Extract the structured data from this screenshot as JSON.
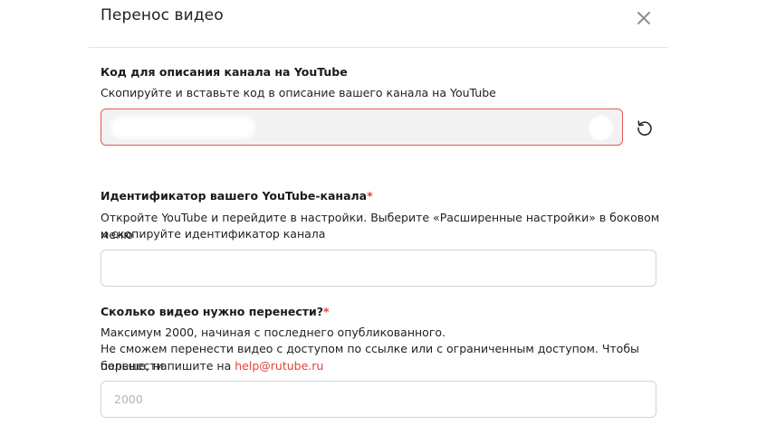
{
  "dialog": {
    "title": "Перенос видео",
    "close_icon": "close-icon"
  },
  "code_section": {
    "label": "Код для описания канала на YouTube",
    "hint": "Скопируйте и вставьте код в описание вашего канала на YouTube",
    "value": "",
    "refresh_icon": "refresh-icon",
    "border_color": "#e35a55"
  },
  "channel_section": {
    "label": "Идентификатор вашего YouTube-канала",
    "required_mark": "*",
    "hint_line1": "Откройте YouTube и перейдите в настройки. Выберите «Расширенные настройки» в боковом меню",
    "hint_line2": "и скопируйте идентификатор канала",
    "value": "",
    "placeholder": ""
  },
  "count_section": {
    "label": "Сколько видео нужно перенести?",
    "required_mark": "*",
    "hint_line1": "Максимум 2000, начиная с последнего опубликованного.",
    "hint_line2": "Не сможем перенести видео с доступом по ссылке или с ограниченным доступом. Чтобы перенести",
    "hint_line3_prefix": "больше, напишите на",
    "email": "help@rutube.ru",
    "placeholder": "2000"
  },
  "colors": {
    "accent": "#e0433d"
  }
}
